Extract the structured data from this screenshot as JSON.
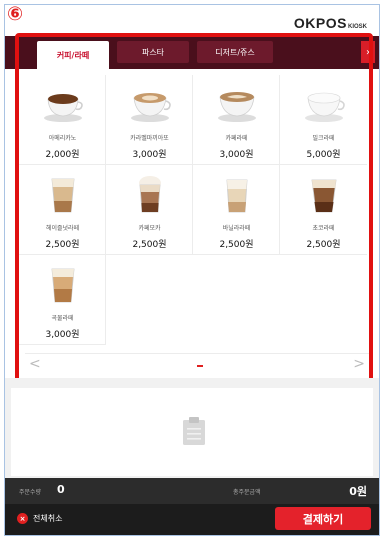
{
  "header": {
    "step_badge": "⑥",
    "brand": "OKPOS",
    "brand_sub": "KIOSK"
  },
  "tabs": [
    {
      "label": "커피/라떼",
      "active": true
    },
    {
      "label": "파스타",
      "active": false
    },
    {
      "label": "디저트/쥬스",
      "active": false
    }
  ],
  "tab_next_icon": "chevron-right-icon",
  "menu_items": [
    {
      "name": "아메리카노",
      "price": "2,000원",
      "icon": "americano-cup-image"
    },
    {
      "name": "카라멜마끼아또",
      "price": "3,000원",
      "icon": "caramel-macchiato-cup-image"
    },
    {
      "name": "카페라떼",
      "price": "3,000원",
      "icon": "cafe-latte-cup-image"
    },
    {
      "name": "밀크라떼",
      "price": "5,000원",
      "icon": "milk-latte-cup-image"
    },
    {
      "name": "헤이즐넛라떼",
      "price": "2,500원",
      "icon": "hazelnut-latte-glass-image"
    },
    {
      "name": "카페모카",
      "price": "2,500원",
      "icon": "cafe-mocha-glass-image"
    },
    {
      "name": "바닐라라떼",
      "price": "2,500원",
      "icon": "vanilla-latte-glass-image"
    },
    {
      "name": "초코라떼",
      "price": "2,500원",
      "icon": "choco-latte-glass-image"
    },
    {
      "name": "곡물라떼",
      "price": "3,000원",
      "icon": "grain-latte-glass-image"
    }
  ],
  "pager": {
    "prev": "<",
    "next": ">"
  },
  "cart": {
    "empty_icon": "clipboard-icon"
  },
  "summary": {
    "qty_label": "주문수량",
    "qty_value": "0",
    "total_label": "총주문금액",
    "total_value": "0원"
  },
  "actions": {
    "cancel_label": "전체취소",
    "cancel_icon": "×",
    "pay_label": "결제하기"
  },
  "colors": {
    "accent_red": "#e4222b",
    "tabbar_maroon": "#4a0f1c",
    "highlight_red": "#e01010"
  }
}
